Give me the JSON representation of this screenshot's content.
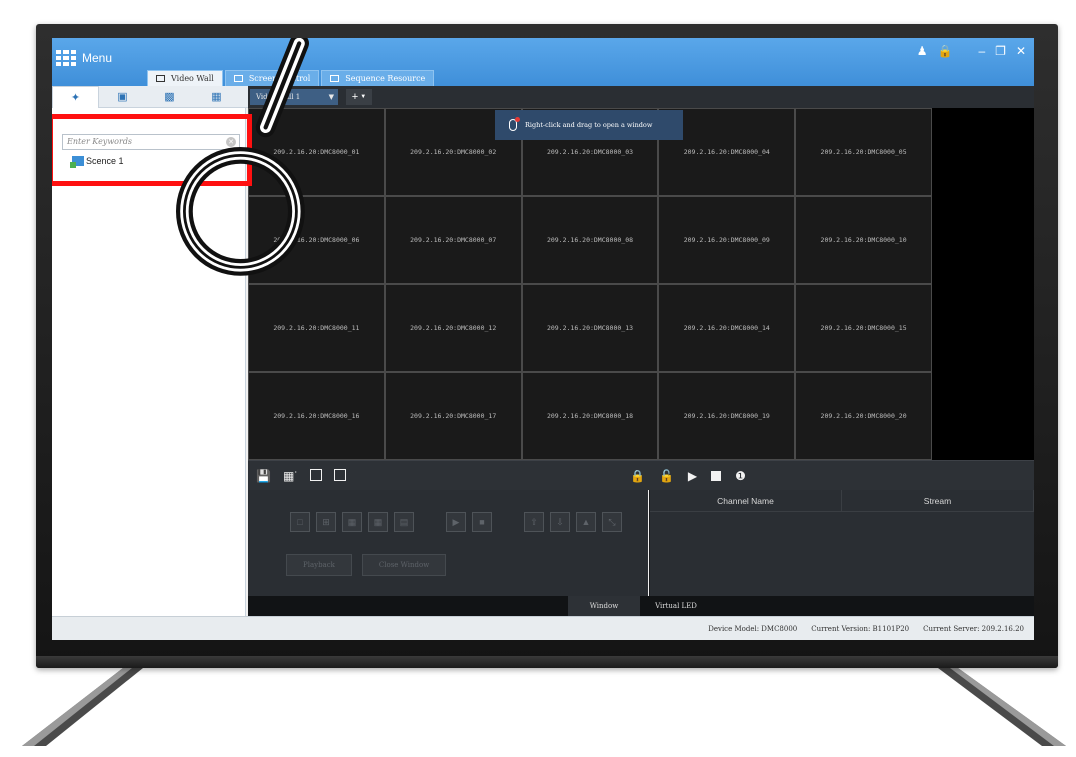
{
  "titlebar": {
    "menu_label": "Menu",
    "controls": [
      "user-icon",
      "lock-icon",
      "minimize-icon",
      "restore-icon",
      "close-icon"
    ]
  },
  "tabs": [
    {
      "label": "Video Wall",
      "active": true
    },
    {
      "label": "Screen Control",
      "active": false
    },
    {
      "label": "Sequence Resource",
      "active": false
    }
  ],
  "left_toolbar": [
    "wall-icon",
    "scene-icon",
    "window-icon",
    "layout-icon"
  ],
  "left_panel": {
    "search_placeholder": "Enter Keywords",
    "tree": [
      {
        "label": "Scence 1"
      }
    ]
  },
  "wall_toolbar": {
    "selected_wall": "Video Wall 1",
    "add_label": "+"
  },
  "tooltip": "Right-click and drag to open a window",
  "cells": [
    "209.2.16.20:DMC8000_01",
    "209.2.16.20:DMC8000_02",
    "209.2.16.20:DMC8000_03",
    "209.2.16.20:DMC8000_04",
    "209.2.16.20:DMC8000_05",
    "209.2.16.20:DMC8000_06",
    "209.2.16.20:DMC8000_07",
    "209.2.16.20:DMC8000_08",
    "209.2.16.20:DMC8000_09",
    "209.2.16.20:DMC8000_10",
    "209.2.16.20:DMC8000_11",
    "209.2.16.20:DMC8000_12",
    "209.2.16.20:DMC8000_13",
    "209.2.16.20:DMC8000_14",
    "209.2.16.20:DMC8000_15",
    "209.2.16.20:DMC8000_16",
    "209.2.16.20:DMC8000_17",
    "209.2.16.20:DMC8000_18",
    "209.2.16.20:DMC8000_19",
    "209.2.16.20:DMC8000_20"
  ],
  "bottom": {
    "playback_label": "Playback",
    "close_window_label": "Close Window",
    "channel_columns": [
      "Channel Name",
      "Stream"
    ],
    "tabs": [
      {
        "label": "Window",
        "active": true
      },
      {
        "label": "Virtual LED",
        "active": false
      }
    ]
  },
  "status": {
    "device_model": "Device Model: DMC8000",
    "current_version": "Current Version: B1101P20",
    "current_server": "Current Server: 209.2.16.20"
  },
  "colors": {
    "titlebar": "#4a9be3",
    "highlight": "#ff1010",
    "wall_bg": "#000000"
  }
}
